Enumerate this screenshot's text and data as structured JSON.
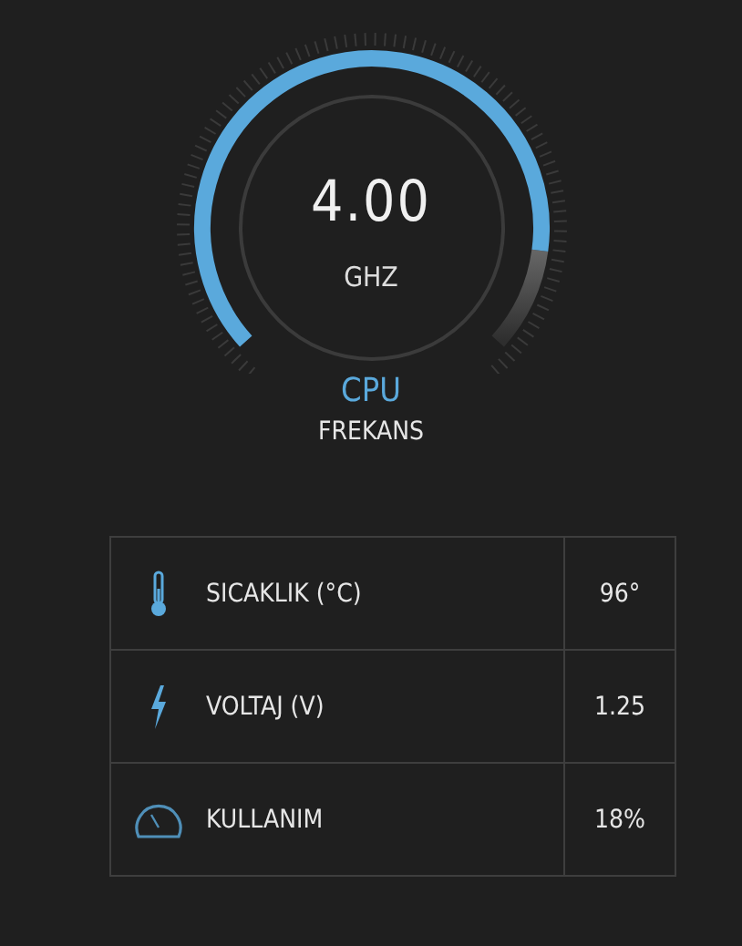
{
  "gauge": {
    "value": "4.00",
    "unit": "GHZ",
    "title": "CPU",
    "subtitle": "FREKANS"
  },
  "stats": [
    {
      "kind": "temperature",
      "label": "SICAKLIK (°C)",
      "value": "96°"
    },
    {
      "kind": "voltage",
      "label": "VOLTAJ (V)",
      "value": "1.25"
    },
    {
      "kind": "usage",
      "label": "KULLANIM",
      "value": "18%"
    }
  ]
}
